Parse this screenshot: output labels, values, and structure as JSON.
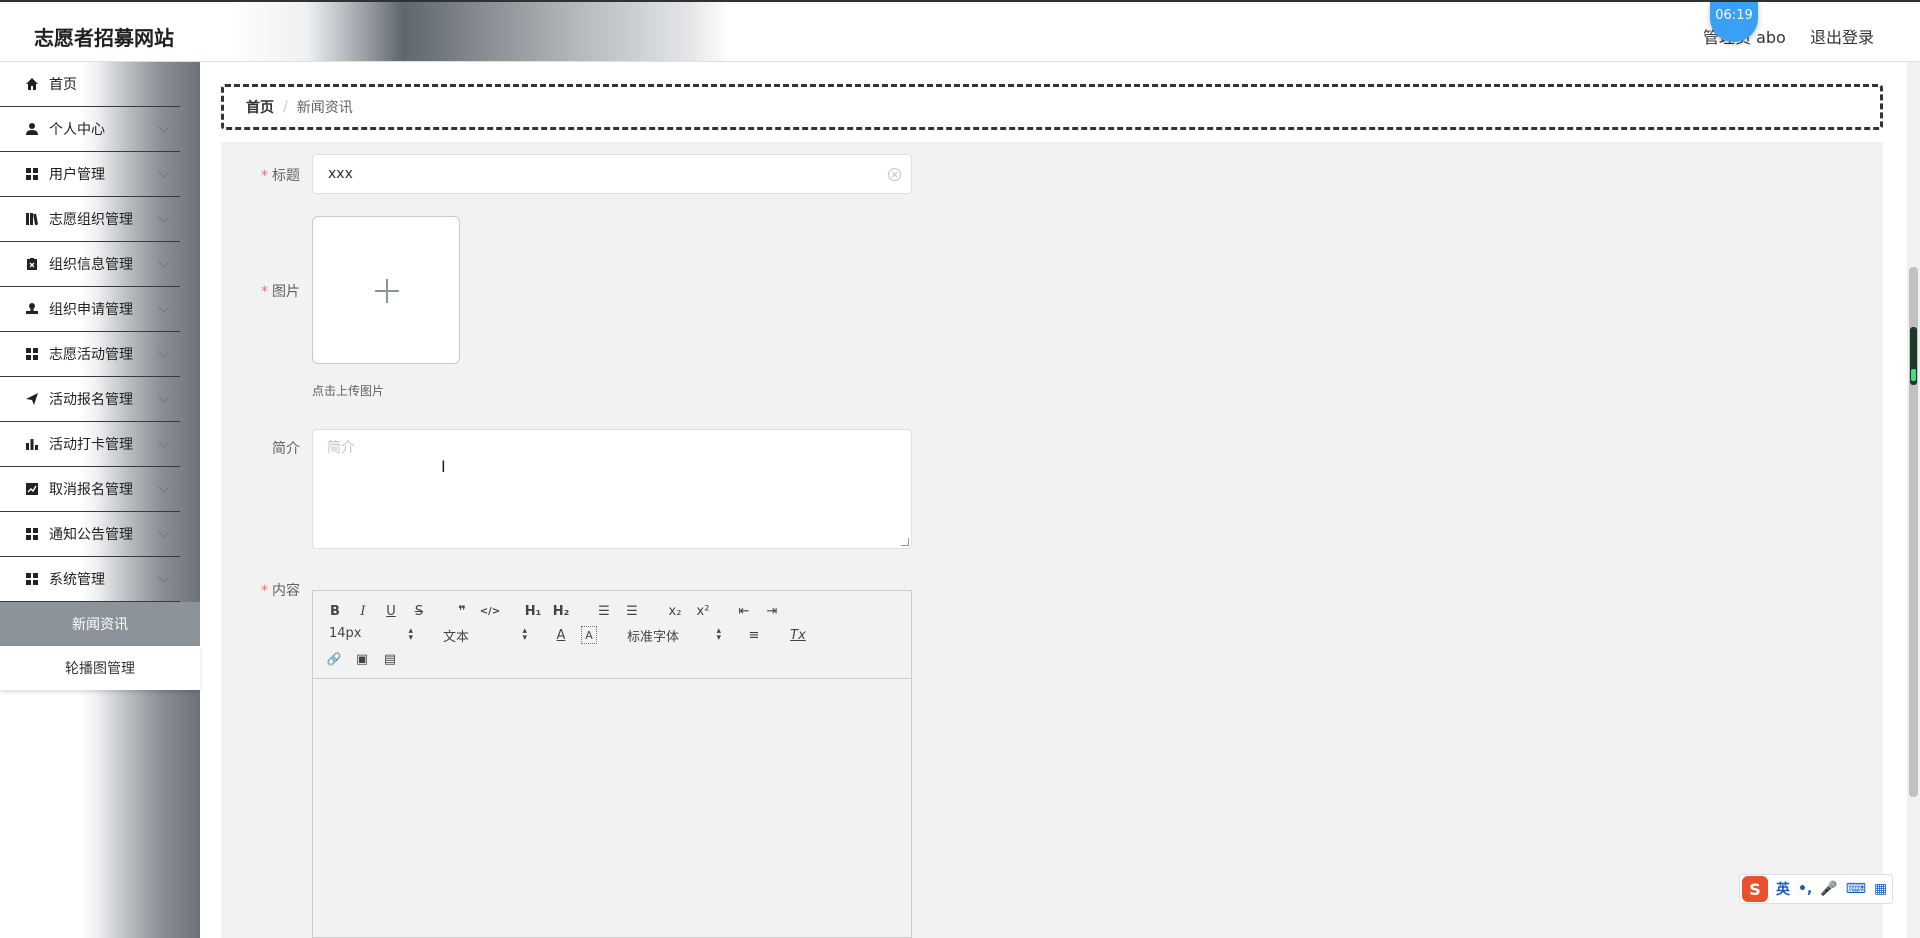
{
  "header": {
    "site_title": "志愿者招募网站",
    "user_label": "管理员 abo",
    "logout_label": "退出登录",
    "time_badge": "06:19"
  },
  "sidebar": {
    "items": [
      {
        "label": "首页",
        "icon": "home-icon"
      },
      {
        "label": "个人中心",
        "icon": "user-icon"
      },
      {
        "label": "用户管理",
        "icon": "grid-icon"
      },
      {
        "label": "志愿组织管理",
        "icon": "book-icon"
      },
      {
        "label": "组织信息管理",
        "icon": "clipboard-icon"
      },
      {
        "label": "组织申请管理",
        "icon": "stamp-icon"
      },
      {
        "label": "志愿活动管理",
        "icon": "grid-icon"
      },
      {
        "label": "活动报名管理",
        "icon": "send-icon"
      },
      {
        "label": "活动打卡管理",
        "icon": "bar-chart-icon"
      },
      {
        "label": "取消报名管理",
        "icon": "line-chart-icon"
      },
      {
        "label": "通知公告管理",
        "icon": "grid-icon"
      },
      {
        "label": "系统管理",
        "icon": "grid-icon"
      }
    ],
    "sub_items": [
      {
        "label": "新闻资讯",
        "active": true
      },
      {
        "label": "轮播图管理",
        "active": false
      }
    ]
  },
  "breadcrumb": {
    "home": "首页",
    "separator": "/",
    "current": "新闻资讯"
  },
  "form": {
    "title_label": "标题",
    "title_value": "xxx",
    "image_label": "图片",
    "upload_tip": "点击上传图片",
    "intro_label": "简介",
    "intro_placeholder": "简介",
    "content_label": "内容",
    "required_mark": "*"
  },
  "editor": {
    "font_size": "14px",
    "header_picker": "文本",
    "font_family": "标准字体",
    "buttons": {
      "bold": "B",
      "italic": "I",
      "underline": "U",
      "strike": "S",
      "quote": "❞",
      "code": "</>",
      "h1": "H₁",
      "h2": "H₂",
      "ordered_list": "☰",
      "bullet_list": "☰",
      "subscript": "x₂",
      "superscript": "x²",
      "outdent": "⇤",
      "indent": "⇥",
      "color": "A",
      "background": "A",
      "align": "≡",
      "clean": "Tx",
      "link": "🔗",
      "image": "▣",
      "video": "▤"
    }
  },
  "ime": {
    "logo": "S",
    "lang": "英",
    "punct": "•,",
    "mic": "🎤",
    "keyboard": "⌨",
    "apps": "▦"
  }
}
